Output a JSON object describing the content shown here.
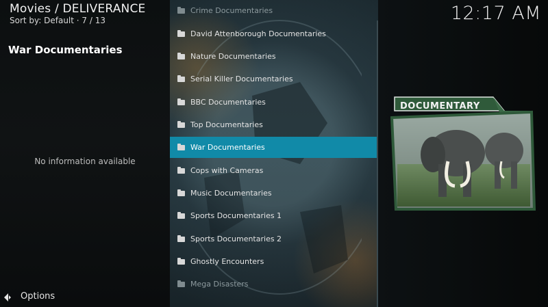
{
  "header": {
    "title": "Movies / DELIVERANCE",
    "sort": "Sort by: Default  ·  7 / 13"
  },
  "clock": "12:17 AM",
  "info": {
    "item_title": "War Documentaries",
    "no_info": "No information available"
  },
  "options": {
    "label": "Options",
    "icon": "options-arrow-icon"
  },
  "list": {
    "items": [
      {
        "label": "Crime Documentaries"
      },
      {
        "label": "David Attenborough Documentaries"
      },
      {
        "label": "Nature Documentaries"
      },
      {
        "label": "Serial Killer Documentaries"
      },
      {
        "label": "BBC Documentaries"
      },
      {
        "label": "Top Documentaries"
      },
      {
        "label": "War Documentaries"
      },
      {
        "label": "Cops with Cameras"
      },
      {
        "label": "Music Documentaries"
      },
      {
        "label": "Sports Documentaries 1"
      },
      {
        "label": "Sports Documentaries 2"
      },
      {
        "label": "Ghostly Encounters"
      },
      {
        "label": "Mega Disasters"
      }
    ],
    "selected_index": 6
  },
  "artwork": {
    "banner": "DOCUMENTARY"
  },
  "colors": {
    "accent": "#118aa8",
    "banner_green": "#2f5a3a"
  }
}
